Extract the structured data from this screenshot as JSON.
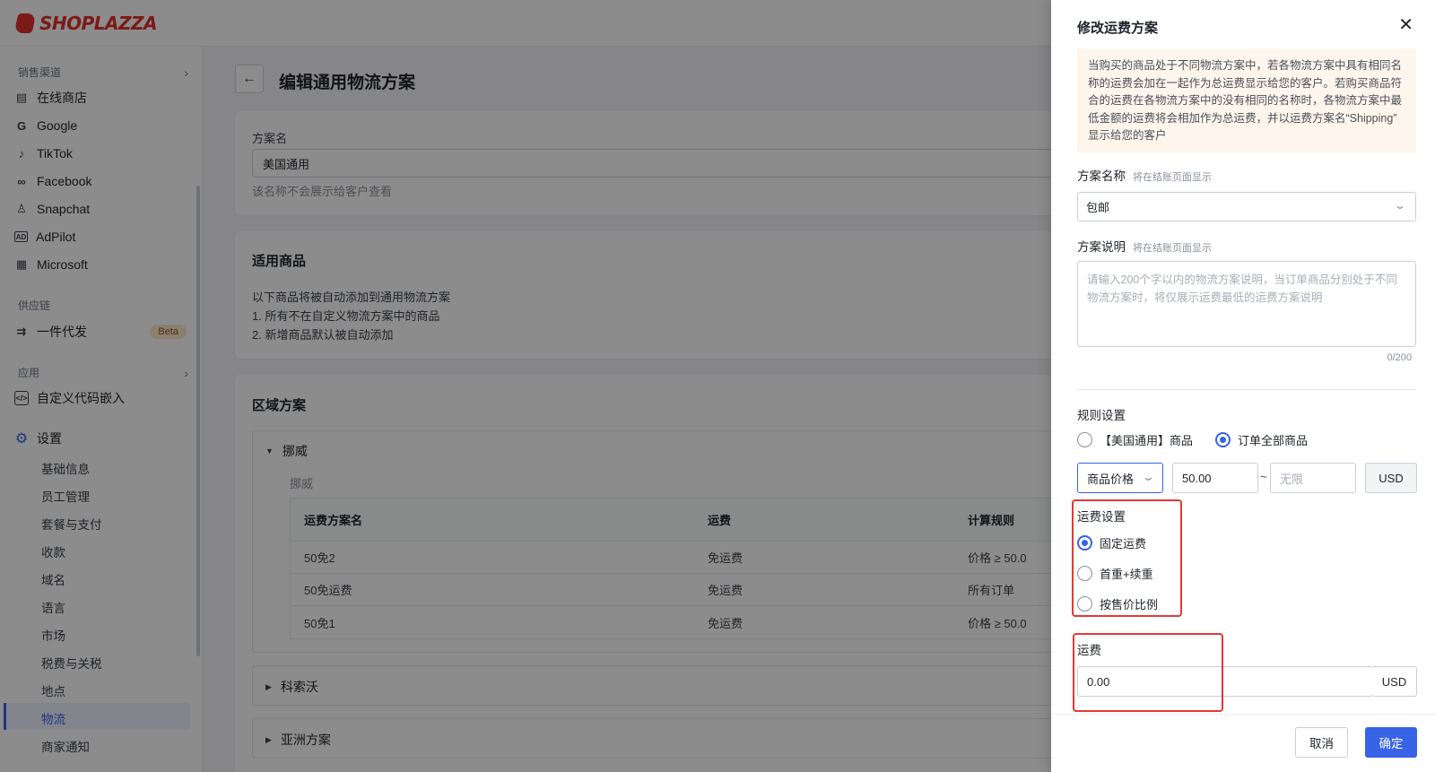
{
  "brand": {
    "name": "SHOPLAZZA",
    "color": "#e0312b"
  },
  "sidebar": {
    "group_sales": "销售渠道",
    "sales_items": [
      {
        "label": "在线商店",
        "icon": "store-icon"
      },
      {
        "label": "Google",
        "icon": "google-icon"
      },
      {
        "label": "TikTok",
        "icon": "tiktok-icon"
      },
      {
        "label": "Facebook",
        "icon": "meta-icon"
      },
      {
        "label": "Snapchat",
        "icon": "snapchat-icon"
      },
      {
        "label": "AdPilot",
        "icon": "ad-icon"
      },
      {
        "label": "Microsoft",
        "icon": "microsoft-icon"
      }
    ],
    "group_supply": "供应链",
    "supply_item": {
      "label": "一件代发",
      "badge": "Beta",
      "icon": "dropship-icon"
    },
    "group_apps": "应用",
    "apps_item": {
      "label": "自定义代码嵌入",
      "icon": "code-icon"
    },
    "settings": {
      "label": "设置",
      "icon": "gear-icon"
    },
    "settings_sub": [
      "基础信息",
      "员工管理",
      "套餐与支付",
      "收款",
      "域名",
      "语言",
      "市场",
      "税费与关税",
      "地点",
      "物流",
      "商家通知"
    ],
    "active": "物流",
    "accent_color": "#3763e7"
  },
  "main": {
    "page_title": "编辑通用物流方案",
    "name_card": {
      "label": "方案名",
      "value": "美国通用",
      "hint": "该名称不会展示给客户查看"
    },
    "products_card": {
      "title": "适用商品",
      "lines": [
        "以下商品将被自动添加到通用物流方案",
        "1. 所有不在自定义物流方案中的商品",
        "2. 新增商品默认被自动添加"
      ]
    },
    "zones_card": {
      "title": "区域方案",
      "zone_open": {
        "name": "挪威",
        "subtitle": "挪威"
      },
      "table_headers": [
        "运费方案名",
        "运费",
        "计算规则"
      ],
      "rows": [
        [
          "50免2",
          "免运费",
          "价格 ≥ 50.0"
        ],
        [
          "50免运费",
          "免运费",
          "所有订单"
        ],
        [
          "50免1",
          "免运费",
          "价格 ≥ 50.0"
        ]
      ],
      "zones_collapsed": [
        "科索沃",
        "亚洲方案"
      ]
    }
  },
  "drawer": {
    "title": "修改运费方案",
    "notice": "当购买的商品处于不同物流方案中，若各物流方案中具有相同名称的运费会加在一起作为总运费显示给您的客户。若购买商品符合的运费在各物流方案中的没有相同的名称时，各物流方案中最低金额的运费将会相加作为总运费，并以运费方案名“Shipping” 显示给您的客户",
    "plan_name_label": "方案名称",
    "plan_name_sub": "将在结账页面显示",
    "plan_name_value": "包邮",
    "plan_desc_label": "方案说明",
    "plan_desc_sub": "将在结账页面显示",
    "plan_desc_placeholder": "请输入200个字以内的物流方案说明，当订单商品分别处于不同物流方案时，将仅展示运费最低的运费方案说明",
    "plan_desc_counter": "0/200",
    "rules_label": "规则设置",
    "rule_options": [
      "【美国通用】商品",
      "订单全部商品"
    ],
    "rule_selected": "订单全部商品",
    "condition_select": "商品价格",
    "min_value": "50.00",
    "max_placeholder": "无限",
    "currency": "USD",
    "fee_settings_label": "运费设置",
    "fee_options": [
      "固定运费",
      "首重+续重",
      "按售价比例"
    ],
    "fee_selected": "固定运费",
    "fee_label": "运费",
    "fee_value": "0.00",
    "fee_currency": "USD",
    "cancel": "取消",
    "confirm": "确定"
  }
}
